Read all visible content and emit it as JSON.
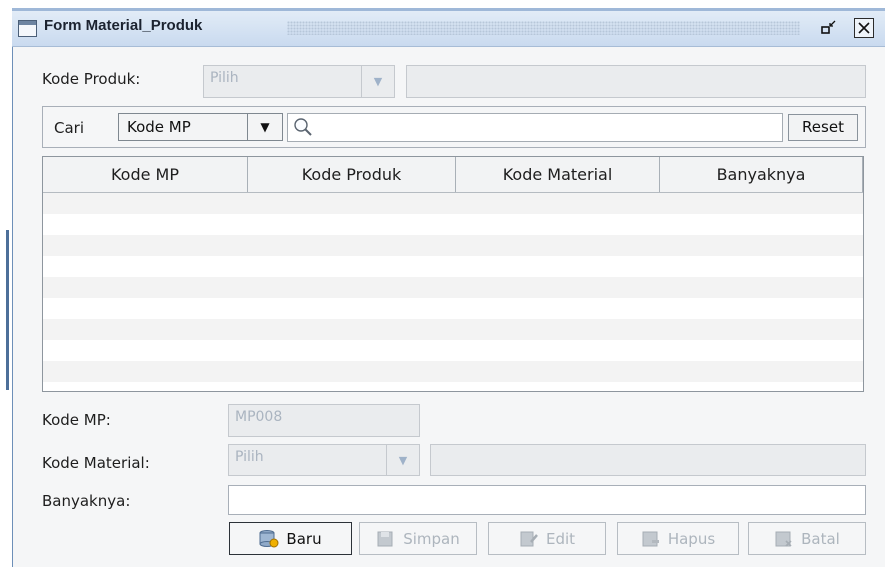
{
  "window": {
    "title": "Form Material_Produk"
  },
  "produk": {
    "label": "Kode Produk:",
    "combo_value": "Pilih",
    "name_value": ""
  },
  "search": {
    "label": "Cari",
    "combo_value": "Kode MP",
    "query": "",
    "reset_label": "Reset"
  },
  "table": {
    "columns": [
      "Kode MP",
      "Kode Produk",
      "Kode Material",
      "Banyaknya"
    ],
    "rows": []
  },
  "form": {
    "kode_mp_label": "Kode MP:",
    "kode_mp_value": "MP008",
    "kode_material_label": "Kode Material:",
    "kode_material_combo": "Pilih",
    "material_name_value": "",
    "banyaknya_label": "Banyaknya:",
    "banyaknya_value": ""
  },
  "buttons": {
    "baru": "Baru",
    "simpan": "Simpan",
    "edit": "Edit",
    "hapus": "Hapus",
    "batal": "Batal"
  },
  "colors": {
    "title_bar": "#c9daef",
    "disabled_text": "#aab4c0",
    "frame": "#f5f6f7"
  },
  "icons": [
    "window-icon",
    "restore-icon",
    "close-icon",
    "search-icon",
    "chevron-down-icon",
    "database-new-icon",
    "save-icon",
    "edit-icon",
    "delete-icon",
    "cancel-icon"
  ]
}
